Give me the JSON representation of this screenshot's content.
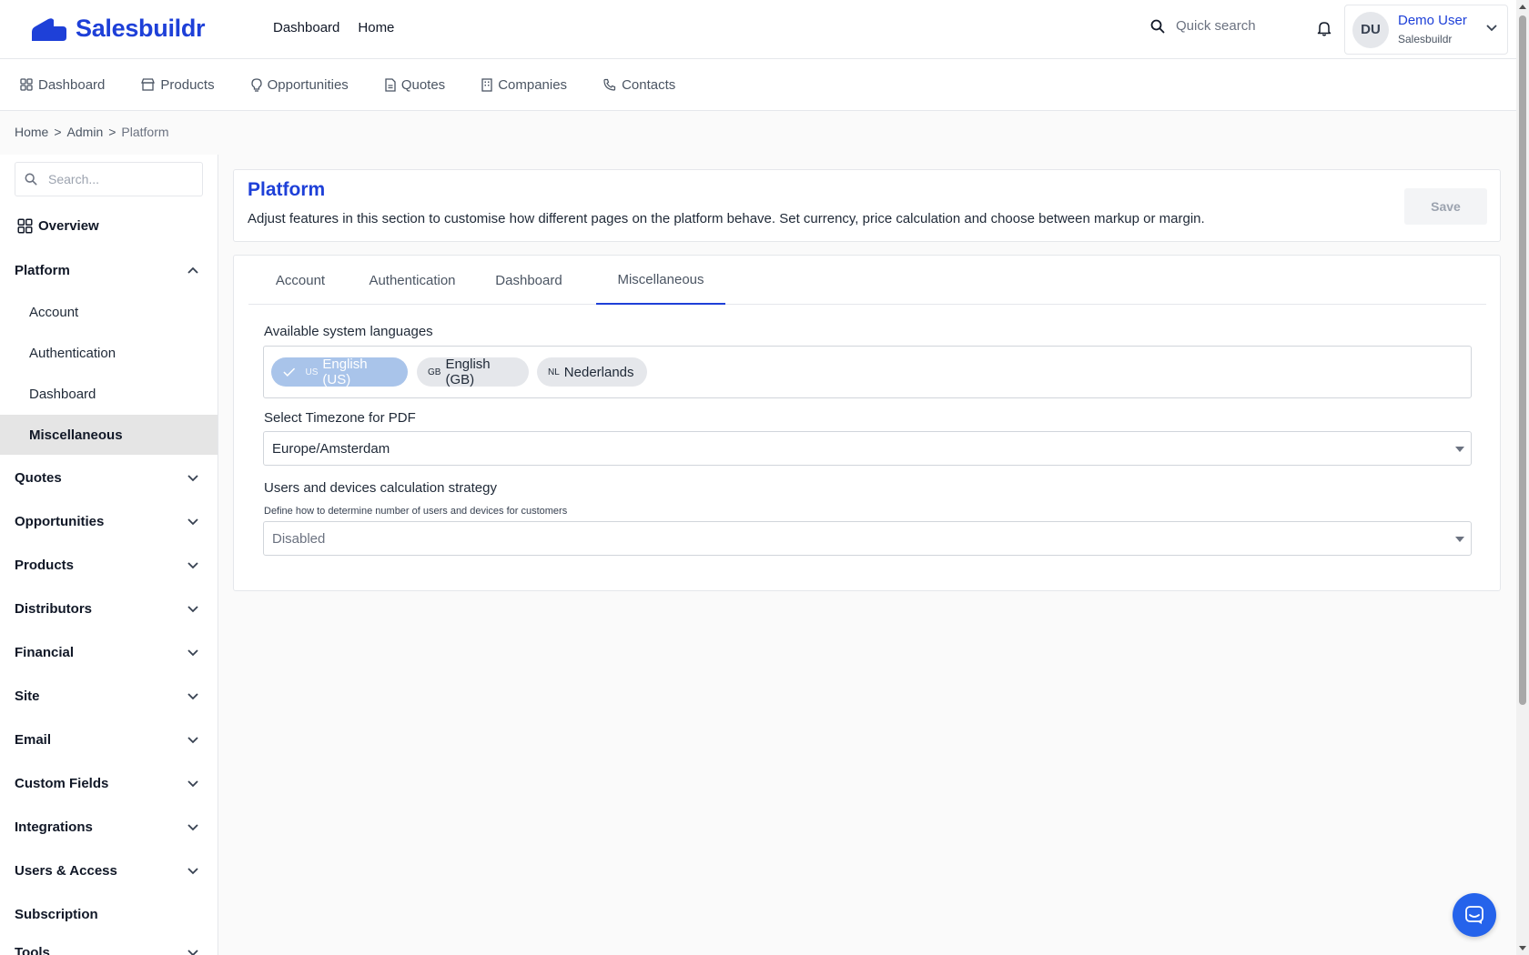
{
  "header": {
    "logo_text": "Salesbuildr",
    "nav": [
      "Dashboard",
      "Home"
    ],
    "quick_search_placeholder": "Quick search",
    "user": {
      "initials": "DU",
      "name": "Demo User",
      "org": "Salesbuildr"
    }
  },
  "subnav": {
    "items": [
      {
        "label": "Dashboard",
        "icon": "grid-icon"
      },
      {
        "label": "Products",
        "icon": "store-icon"
      },
      {
        "label": "Opportunities",
        "icon": "lightbulb-icon"
      },
      {
        "label": "Quotes",
        "icon": "document-icon"
      },
      {
        "label": "Companies",
        "icon": "building-icon"
      },
      {
        "label": "Contacts",
        "icon": "phone-icon"
      }
    ]
  },
  "breadcrumb": {
    "items": [
      "Home",
      "Admin",
      "Platform"
    ],
    "separator": ">"
  },
  "sidebar": {
    "search_placeholder": "Search...",
    "overview_label": "Overview",
    "platform_label": "Platform",
    "platform_items": [
      "Account",
      "Authentication",
      "Dashboard",
      "Miscellaneous"
    ],
    "active_item": "Miscellaneous",
    "sections": [
      "Quotes",
      "Opportunities",
      "Products",
      "Distributors",
      "Financial",
      "Site",
      "Email",
      "Custom Fields",
      "Integrations",
      "Users & Access"
    ],
    "subscription_label": "Subscription",
    "cut_off_label": "Tools"
  },
  "main": {
    "title": "Platform",
    "description": "Adjust features in this section to customise how different pages on the platform behave. Set currency, price calculation and choose between markup or margin.",
    "save_label": "Save",
    "tabs": [
      "Account",
      "Authentication",
      "Dashboard",
      "Miscellaneous"
    ],
    "active_tab": "Miscellaneous",
    "languages": {
      "label": "Available system languages",
      "options": [
        {
          "label": "English (US)",
          "flag": "US",
          "selected": true
        },
        {
          "label": "English (GB)",
          "flag": "GB",
          "selected": false
        },
        {
          "label": "Nederlands",
          "flag": "NL",
          "selected": false
        }
      ]
    },
    "timezone": {
      "label": "Select Timezone for PDF",
      "value": "Europe/Amsterdam"
    },
    "strategy": {
      "label": "Users and devices calculation strategy",
      "hint": "Define how to determine number of users and devices for customers",
      "value": "Disabled"
    }
  },
  "colors": {
    "brand": "#1e40d8",
    "chip_selected": "#a9c4ea",
    "chip_unselected": "#e5e7eb",
    "active_sidebar": "#e5e5e5",
    "chat": "#2563eb"
  }
}
